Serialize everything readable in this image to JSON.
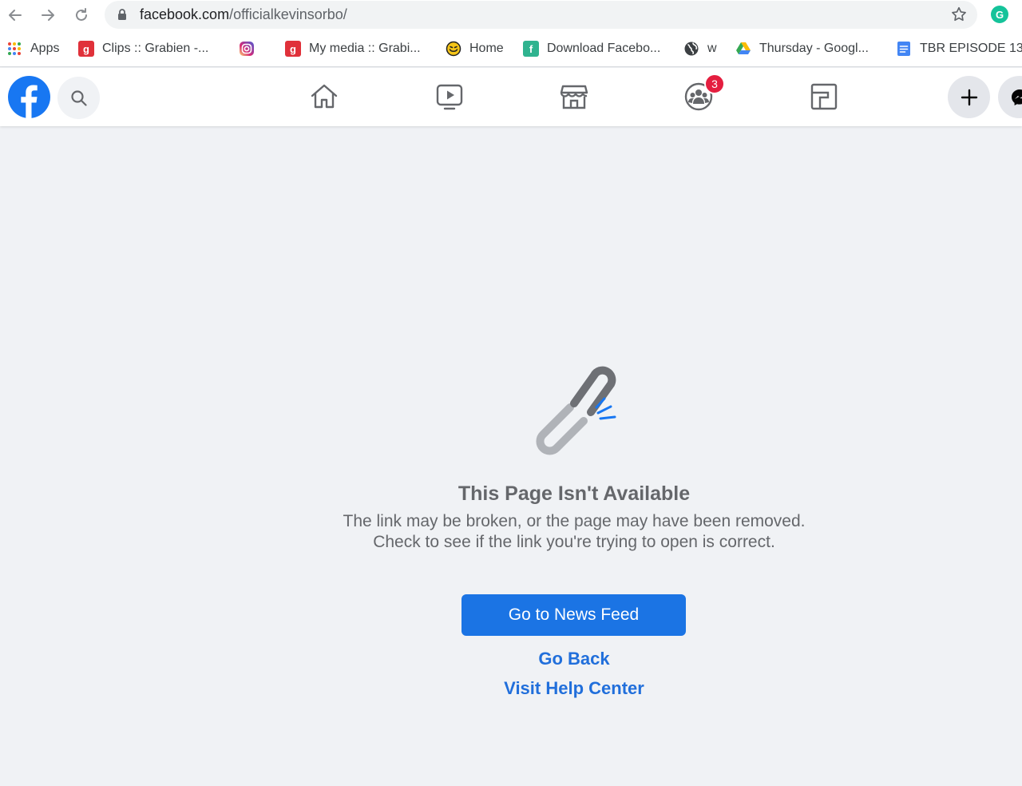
{
  "browser": {
    "url_domain": "facebook.com",
    "url_path": "/officialkevinsorbo/",
    "extension_letter": "G"
  },
  "bookmarks": [
    {
      "label": "Apps",
      "icon": "apps-grid-icon"
    },
    {
      "label": "Clips :: Grabien -...",
      "icon": "grabien-icon",
      "glyph": "g",
      "color": "#e0313a"
    },
    {
      "label": "",
      "icon": "instagram-icon"
    },
    {
      "label": "My media :: Grabi...",
      "icon": "grabien-icon",
      "glyph": "g",
      "color": "#e0313a"
    },
    {
      "label": "Home",
      "icon": "home-smile-icon"
    },
    {
      "label": "Download Facebo...",
      "icon": "download-icon",
      "glyph": "f",
      "color": "#2fb38f"
    },
    {
      "label": "w",
      "icon": "globe-icon"
    },
    {
      "label": "Thursday - Googl...",
      "icon": "google-drive-icon"
    },
    {
      "label": "TBR EPISODE 13",
      "icon": "google-docs-icon"
    }
  ],
  "header": {
    "notification_count": "3"
  },
  "error": {
    "title": "This Page Isn't Available",
    "description": "The link may be broken, or the page may have been removed. Check to see if the link you're trying to open is correct.",
    "primary_button": "Go to News Feed",
    "go_back": "Go Back",
    "help_center": "Visit Help Center"
  },
  "colors": {
    "brand_blue": "#1877f2",
    "button_blue": "#1b74e4",
    "link_blue": "#216fdb",
    "badge_red": "#e41e3f",
    "page_bg": "#f0f2f5"
  }
}
